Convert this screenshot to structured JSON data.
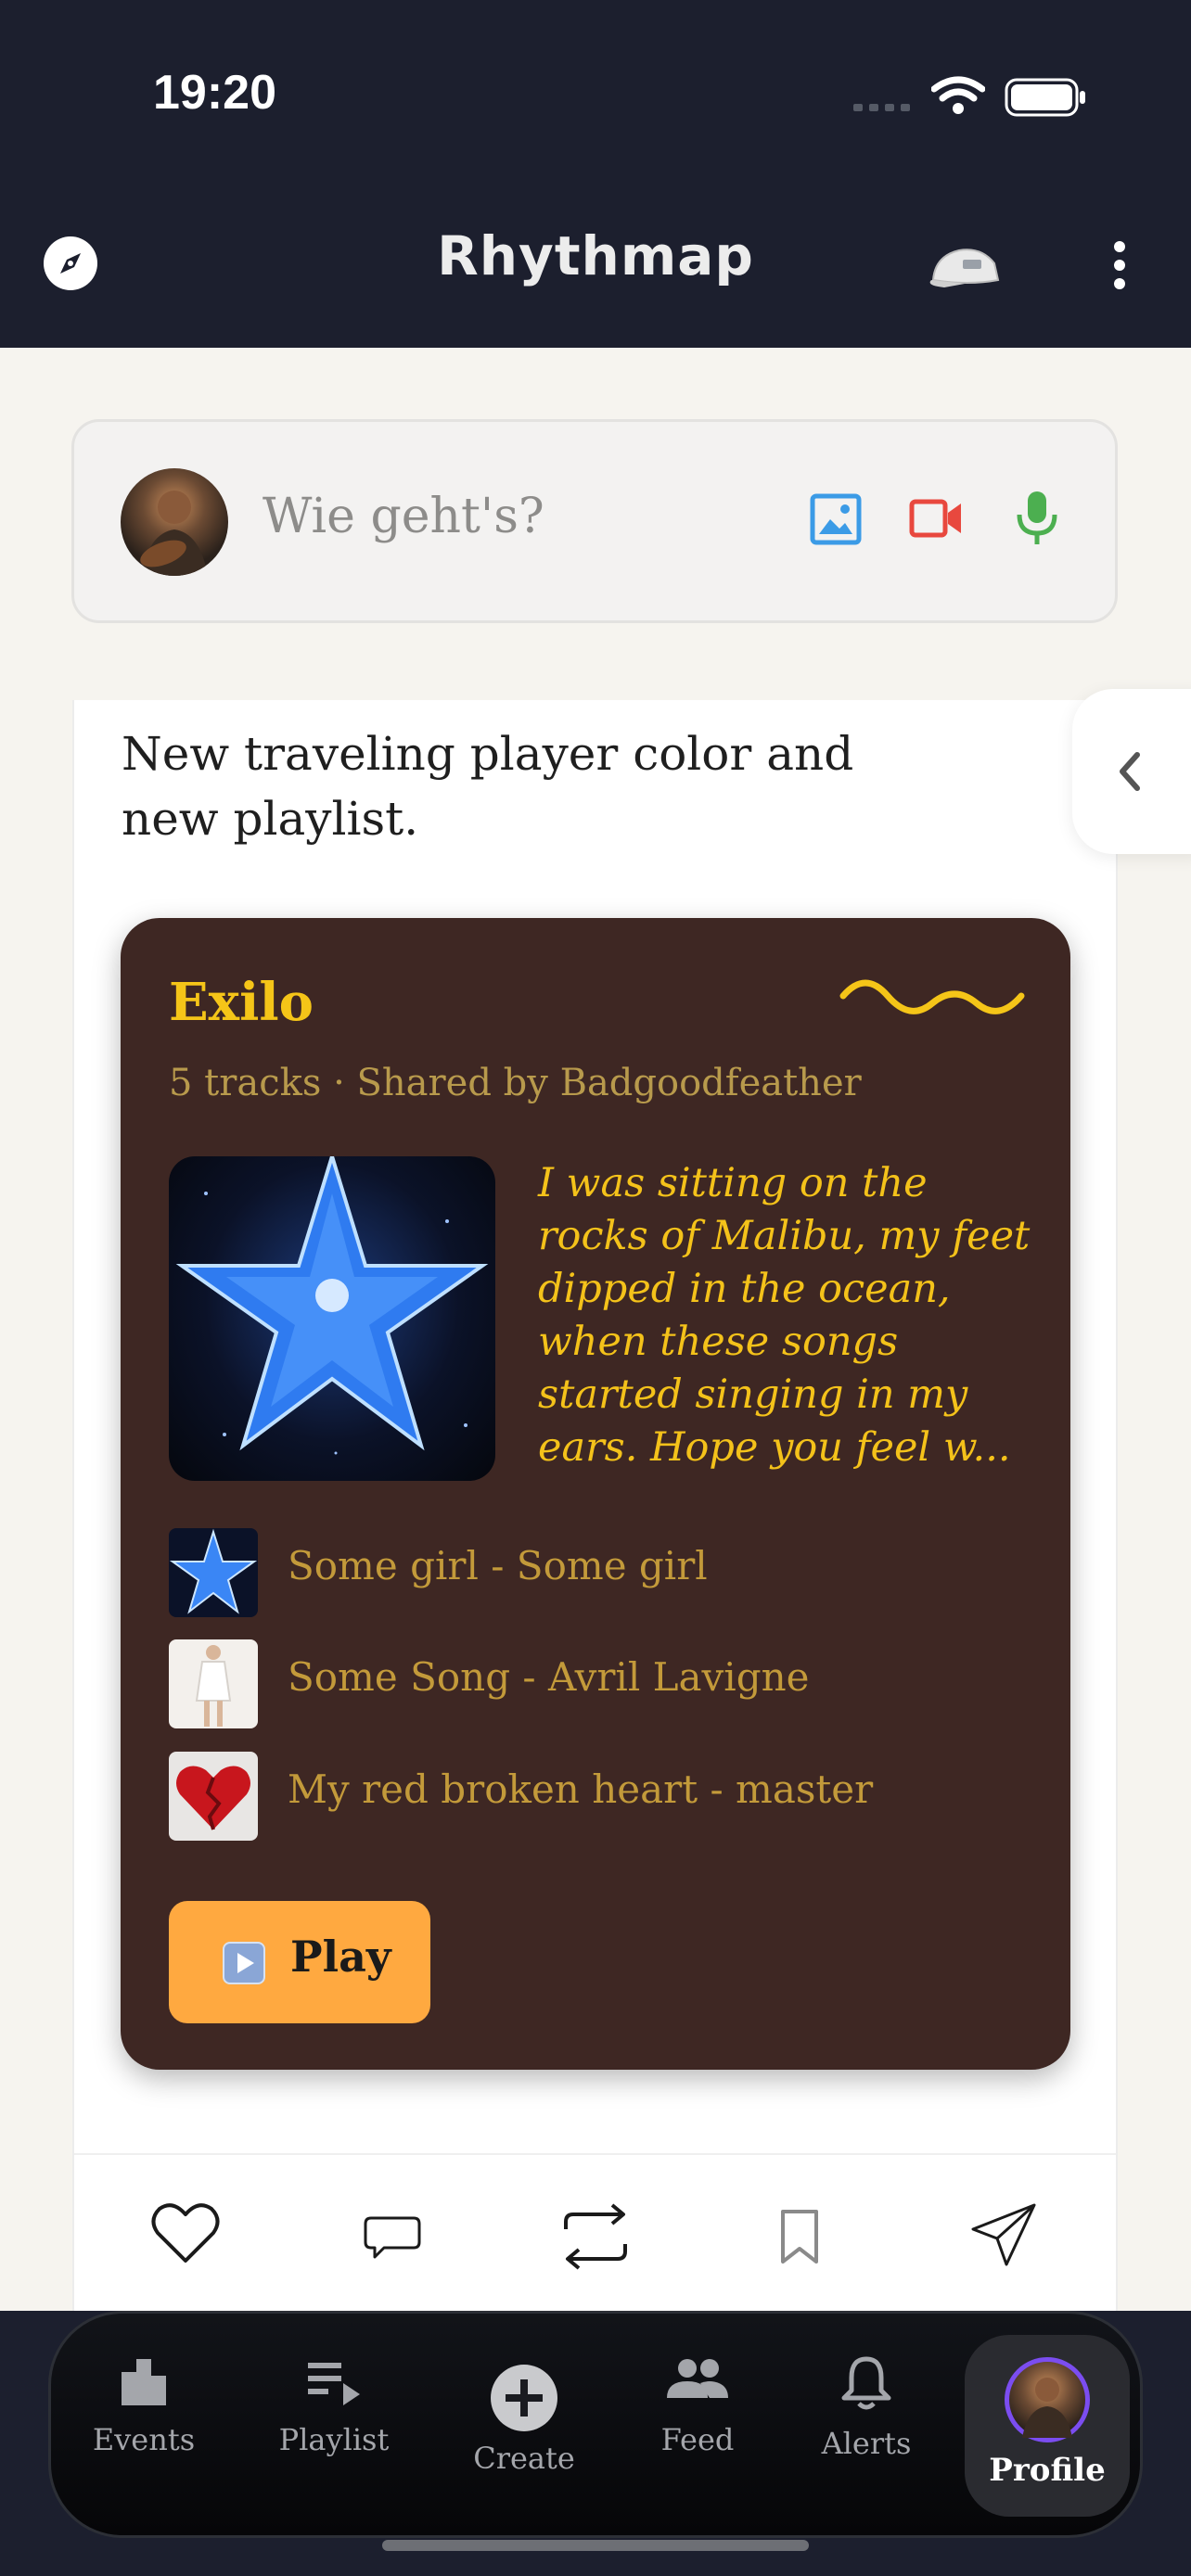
{
  "status_bar": {
    "time": "19:20"
  },
  "header": {
    "title": "Rhythmap"
  },
  "composer": {
    "placeholder": "Wie geht's?"
  },
  "post": {
    "text": "New traveling player color and new playlist.",
    "playlist": {
      "title": "Exilo",
      "meta": "5 tracks · Shared by Badgoodfeather",
      "description": "I was sitting on the rocks of Malibu, my feet dipped in the ocean, when these songs started singing in my ears. Hope you feel w...",
      "tracks": [
        {
          "label": "Some girl - Some girl"
        },
        {
          "label": "Some Song - Avril Lavigne"
        },
        {
          "label": "My red broken heart - master"
        }
      ],
      "play_label": "Play"
    }
  },
  "bottom_nav": {
    "items": [
      {
        "label": "Events"
      },
      {
        "label": "Playlist"
      },
      {
        "label": "Create"
      },
      {
        "label": "Feed"
      },
      {
        "label": "Alerts"
      },
      {
        "label": "Profile"
      }
    ],
    "active": "Profile"
  },
  "colors": {
    "header_bg": "#1c1f2e",
    "playlist_card_bg": "#3e2723",
    "playlist_title": "#f5c518",
    "play_button": "#ffa940",
    "profile_ring": "#7b4df0"
  }
}
